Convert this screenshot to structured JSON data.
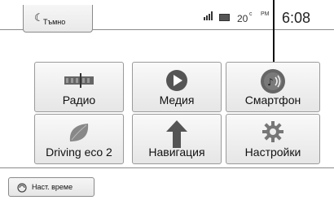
{
  "header": {
    "mode_label": "Тъмно",
    "clock_partial": "20",
    "superscript": "c",
    "ampm": "PM",
    "time": "6:08"
  },
  "tiles": [
    {
      "label": "Радио",
      "icon": "radio-icon"
    },
    {
      "label": "Медия",
      "icon": "media-play-icon"
    },
    {
      "label": "Смартфон",
      "icon": "smartphone-icon"
    },
    {
      "label": "Driving eco 2",
      "icon": "eco-leaf-icon"
    },
    {
      "label": "Навигация",
      "icon": "navigation-arrow-icon"
    },
    {
      "label": "Настройки",
      "icon": "settings-gear-icon"
    }
  ],
  "footer": {
    "label": "Наст. време",
    "icon": "weather-icon"
  }
}
